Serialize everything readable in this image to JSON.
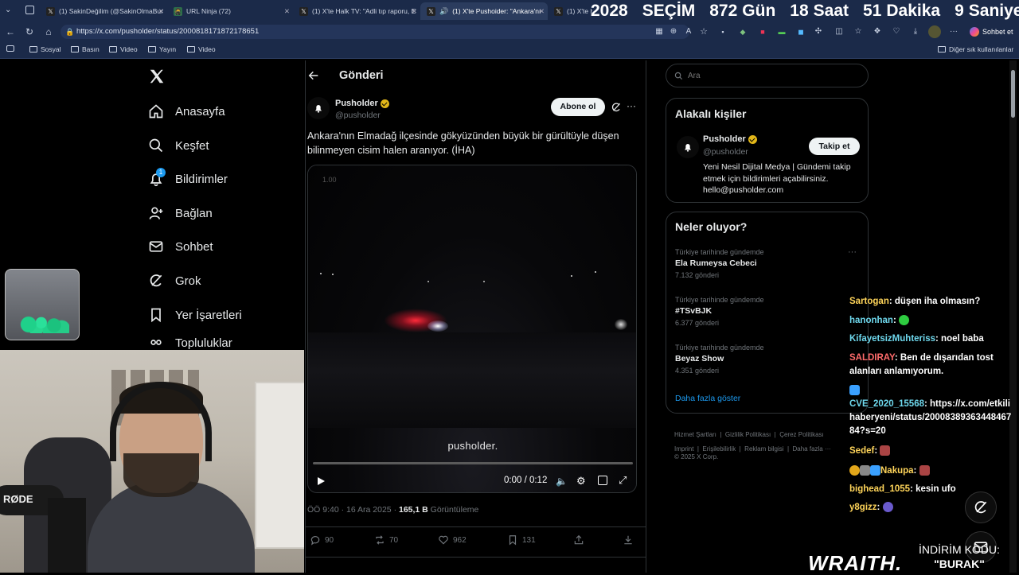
{
  "browser": {
    "tabs": [
      {
        "label": "(1) SakinDeğilim (@SakinOlmaBur",
        "icon": "x-logo"
      },
      {
        "label": "URL Ninja (72)",
        "icon": "ninja-icon"
      },
      {
        "label": "(1) X'te Halk TV: \"Adli tıp raporu, E",
        "icon": "x-logo"
      },
      {
        "label": "(1) X'te Pushoider: \"Ankara'nı",
        "icon": "x-logo"
      },
      {
        "label": "(1) X'te H",
        "icon": "x-logo"
      }
    ],
    "url": "https://x.com/pusholder/status/2000818171872178651",
    "bookmarks": [
      "Sosyal",
      "Basın",
      "Video",
      "Yayın",
      "Video"
    ],
    "other_bookmarks": "Diğer sık kullanılanlar",
    "chat_button": "Sohbet et"
  },
  "countdown": {
    "year": "2028",
    "label": "SEÇİM",
    "days": "872",
    "days_unit": "Gün",
    "hours": "18",
    "hours_unit": "Saat",
    "minutes": "51",
    "minutes_unit": "Dakika",
    "seconds": "9",
    "seconds_unit": "Saniye"
  },
  "sidebar": {
    "items": [
      {
        "label": "Anasayfa",
        "icon": "home-icon"
      },
      {
        "label": "Keşfet",
        "icon": "search-icon"
      },
      {
        "label": "Bildirimler",
        "icon": "bell-icon",
        "badge": "1"
      },
      {
        "label": "Bağlan",
        "icon": "person-add-icon"
      },
      {
        "label": "Sohbet",
        "icon": "mail-icon"
      },
      {
        "label": "Grok",
        "icon": "grok-icon"
      },
      {
        "label": "Yer İşaretleri",
        "icon": "bookmark-icon"
      },
      {
        "label": "Topluluklar",
        "icon": "people-icon"
      }
    ]
  },
  "post": {
    "header_title": "Gönderi",
    "author_name": "Pusholder",
    "author_handle": "@pusholder",
    "subscribe_label": "Abone ol",
    "text": "Ankara'nın Elmadağ ilçesinde gökyüzünden büyük bir gürültüyle düşen bilinmeyen cisim halen aranıyor. (İHA)",
    "video": {
      "speed_label": "1.00",
      "watermark": "pusholder.",
      "time": "0:00 / 0:12",
      "progress": 0
    },
    "timestamp": "ÖÖ 9:40 · 16 Ara 2025 · ",
    "views_count": "165,1 B",
    "views_label": " Görüntüleme",
    "actions": {
      "replies": "90",
      "reposts": "70",
      "likes": "962",
      "bookmarks": "131"
    }
  },
  "right": {
    "search_placeholder": "Ara",
    "related_title": "Alakalı kişiler",
    "related": {
      "name": "Pusholder",
      "handle": "@pusholder",
      "follow_label": "Takip et",
      "bio": "Yeni Nesil Dijital Medya | Gündemi takip etmek için bildirimleri açabilirsiniz. hello@pusholder.com"
    },
    "trends_title": "Neler oluyor?",
    "trends": [
      {
        "category": "Türkiye tarihinde gündemde",
        "name": "Ela Rumeysa Cebeci",
        "count": "7.132 gönderi"
      },
      {
        "category": "Türkiye tarihinde gündemde",
        "name": "#TSvBJK",
        "count": "6.377 gönderi"
      },
      {
        "category": "Türkiye tarihinde gündemde",
        "name": "Beyaz Show",
        "count": "4.351 gönderi"
      }
    ],
    "show_more": "Daha fazla göster",
    "footer": [
      "Hizmet Şartları",
      "Gizlilik Politikası",
      "Çerez Politikası",
      "Imprint",
      "Erişilebilirlik",
      "Reklam bilgisi",
      "Daha fazla ···"
    ],
    "copyright": "© 2025 X Corp."
  },
  "chat": [
    {
      "user": "Sartogan",
      "msg": "düşen iha olmasın?",
      "color": "#ffd55a"
    },
    {
      "user": "hanonhan",
      "msg": "",
      "color": "#6fd9ee"
    },
    {
      "user": "KifayetsizMuhteriss",
      "msg": "noel baba",
      "color": "#6fd9ee"
    },
    {
      "user": "SALDIRAY",
      "msg": "Ben de dışarıdan tost alanları anlamıyorum.",
      "color": "#ff6b6b"
    },
    {
      "user": "CVE_2020_15568",
      "msg": "https://x.com/etkilihaberyeni/status/2000838936344846784?s=20",
      "color": "#6fd9ee"
    },
    {
      "user": "Sedef",
      "msg": "",
      "color": "#ffd55a"
    },
    {
      "user": "Nakupa",
      "msg": "",
      "color": "#ffd55a"
    },
    {
      "user": "bighead_1055",
      "msg": "kesin ufo",
      "color": "#ffd55a"
    },
    {
      "user": "y8gizz",
      "msg": "",
      "color": "#ffd55a"
    }
  ],
  "overlay": {
    "brand": "WRAITH.",
    "promo_line1": "İNDİRİM KODU:",
    "promo_line2": "\"BURAK\"",
    "mic_label": "RØDE"
  }
}
